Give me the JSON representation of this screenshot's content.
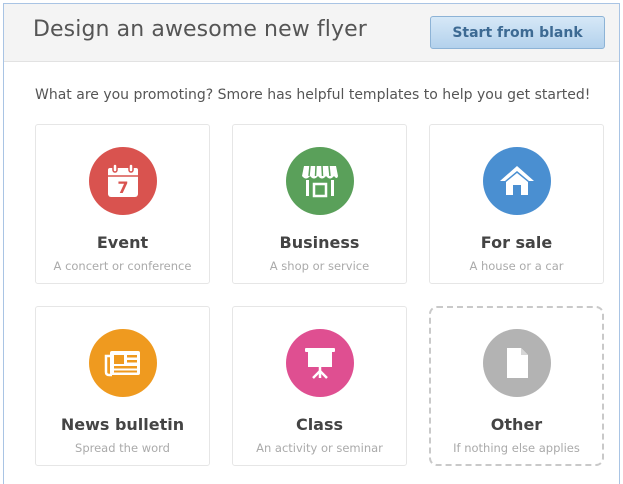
{
  "header": {
    "title": "Design an awesome new flyer",
    "blank_button": "Start from blank"
  },
  "intro": "What are you promoting? Smore has helpful templates to help you get started!",
  "templates": [
    {
      "title": "Event",
      "subtitle": "A concert or conference",
      "icon": "calendar-icon",
      "color": "#d9534f"
    },
    {
      "title": "Business",
      "subtitle": "A shop or service",
      "icon": "storefront-icon",
      "color": "#5aa05a"
    },
    {
      "title": "For sale",
      "subtitle": "A house or a car",
      "icon": "house-icon",
      "color": "#4a8fd1"
    },
    {
      "title": "News bulletin",
      "subtitle": "Spread the word",
      "icon": "newspaper-icon",
      "color": "#ef9a1f"
    },
    {
      "title": "Class",
      "subtitle": "An activity or seminar",
      "icon": "presentation-board-icon",
      "color": "#df4f91"
    },
    {
      "title": "Other",
      "subtitle": "If nothing else applies",
      "icon": "document-icon",
      "color": "#b3b3b3"
    }
  ],
  "calendar_day": "7"
}
